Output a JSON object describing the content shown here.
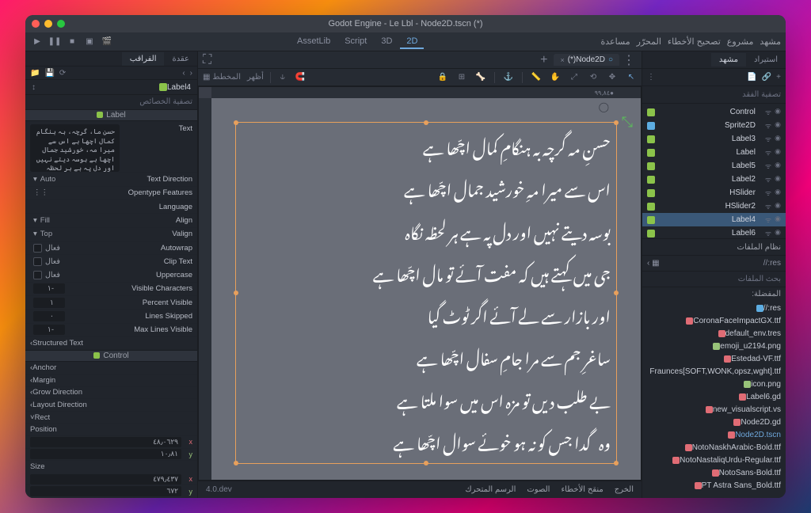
{
  "titlebar": "Godot Engine - Le Lbl - Node2D.tscn (*)",
  "menubar": {
    "editors": {
      "2d": "2D",
      "3d": "3D",
      "script": "Script",
      "assetlib": "AssetLib"
    },
    "menus": [
      "مشهد",
      "مشروع",
      "تصحيح الأخطاء",
      "المحرّر",
      "مساعدة"
    ]
  },
  "scene_dock": {
    "tabs": {
      "scene": "مشهد",
      "import": "استيراد"
    },
    "filter_placeholder": "تصفية الفقد",
    "nodes": [
      {
        "name": "Control",
        "type": "green"
      },
      {
        "name": "Sprite2D",
        "type": "blue"
      },
      {
        "name": "Label3",
        "type": "green"
      },
      {
        "name": "Label",
        "type": "green"
      },
      {
        "name": "Label5",
        "type": "green"
      },
      {
        "name": "Label2",
        "type": "green"
      },
      {
        "name": "HSlider",
        "type": "green"
      },
      {
        "name": "HSlider2",
        "type": "green"
      },
      {
        "name": "Label4",
        "type": "green",
        "selected": true
      },
      {
        "name": "Label6",
        "type": "green"
      }
    ]
  },
  "filesystem": {
    "header": "نظام الملفات",
    "path": "res://",
    "search_placeholder": "بحث الملفات",
    "favorites_label": "المفضلة:",
    "items": [
      {
        "name": "res://",
        "folder": true
      },
      {
        "name": "CoronaFaceImpactGX.ttf"
      },
      {
        "name": "default_env.tres"
      },
      {
        "name": "emoji_u2194.png",
        "img": true
      },
      {
        "name": "Estedad-VF.ttf"
      },
      {
        "name": "Fraunces[SOFT,WONK,opsz,wght].ttf"
      },
      {
        "name": "icon.png",
        "img": true
      },
      {
        "name": "Label6.gd"
      },
      {
        "name": "new_visualscript.vs"
      },
      {
        "name": "Node2D.gd"
      },
      {
        "name": "Node2D.tscn",
        "selected": true
      },
      {
        "name": "NotoNaskhArabic-Bold.ttf"
      },
      {
        "name": "NotoNastaliqUrdu-Regular.ttf"
      },
      {
        "name": "NotoSans-Bold.ttf"
      },
      {
        "name": "PT Astra Sans_Bold.ttf"
      }
    ]
  },
  "inspector": {
    "tabs": {
      "inspector": "الفراقب",
      "node": "عقدة"
    },
    "node_name": "Label4",
    "filter_placeholder": "تصفية الخصائص",
    "section_label": "Label",
    "section_control": "Control",
    "text_sample": "حسنِ ما، گرچہ، بہ ہنگام کمال اچھا ہے\nاس سے میرا مہ، خورشید جمال اچھا ہے\nبوسہ دیتے نہیں اور دل پہ ہے ہر لحظہ نگاہ\nجی میں کہتے ہیں کہ، مفت آئے تو مال اچھا ہے",
    "props": {
      "text": "Text",
      "text_direction": "Text Direction",
      "text_direction_val": "Auto",
      "opentype": "Opentype Features",
      "language": "Language",
      "align": "Align",
      "align_val": "Fill",
      "valign": "Valign",
      "valign_val": "Top",
      "autowrap": "Autowrap",
      "autowrap_val": "فعال",
      "cliptext": "Clip Text",
      "cliptext_val": "فعال",
      "uppercase": "Uppercase",
      "uppercase_val": "فعال",
      "visible_chars": "Visible Characters",
      "visible_chars_val": "-١",
      "percent_visible": "Percent Visible",
      "percent_visible_val": "١",
      "lines_skipped": "Lines Skipped",
      "lines_skipped_val": "٠",
      "max_lines": "Max Lines Visible",
      "max_lines_val": "-١",
      "structured": "Structured Text",
      "anchor": "Anchor",
      "margin": "Margin",
      "grow": "Grow Direction",
      "layout": "Layout Direction",
      "rect": "Rect",
      "position": "Position",
      "size": "Size",
      "pos_x": "٤٨٫٠٦٢٩",
      "pos_y": "١٠٫٨١",
      "size_x": "٤٧٩٫٤٣٧",
      "size_y": "٦٧٢"
    }
  },
  "center": {
    "scene_tab": "(*)Node2D",
    "ruler_coord": "٩٩,٨٤",
    "view_menu": "أظهر",
    "grid_menu": "المخطط",
    "urdu_lines": [
      "حسنِ مہ گرچہ بہ ہنگامِ کمال اچّھا ہے",
      "اس سے میرا مہِ خورشید جمال اچّھا ہے",
      "بوسہ دیتے نہیں اور دل پہ ہے ہر لحظہ نگاہ",
      "جی میں کہتے ہیں کہ مفت آئے تو مال اچّھا ہے",
      "اور بازار سے لے آئے اگر ٹوٹ گیا",
      "ساغرِ جم سے مرا جامِ سفال اچّھا ہے",
      "بے طلب دیں تو مزہ اس میں سوا ملتا ہے",
      "وہ گدا جس کو نہ ہو خوئے سوال اچّھا ہے"
    ]
  },
  "bottom": {
    "tabs": [
      "الخرج",
      "منقح الأخطاء",
      "الصوت",
      "الرسم المتحرك"
    ],
    "version": "4.0.dev"
  }
}
